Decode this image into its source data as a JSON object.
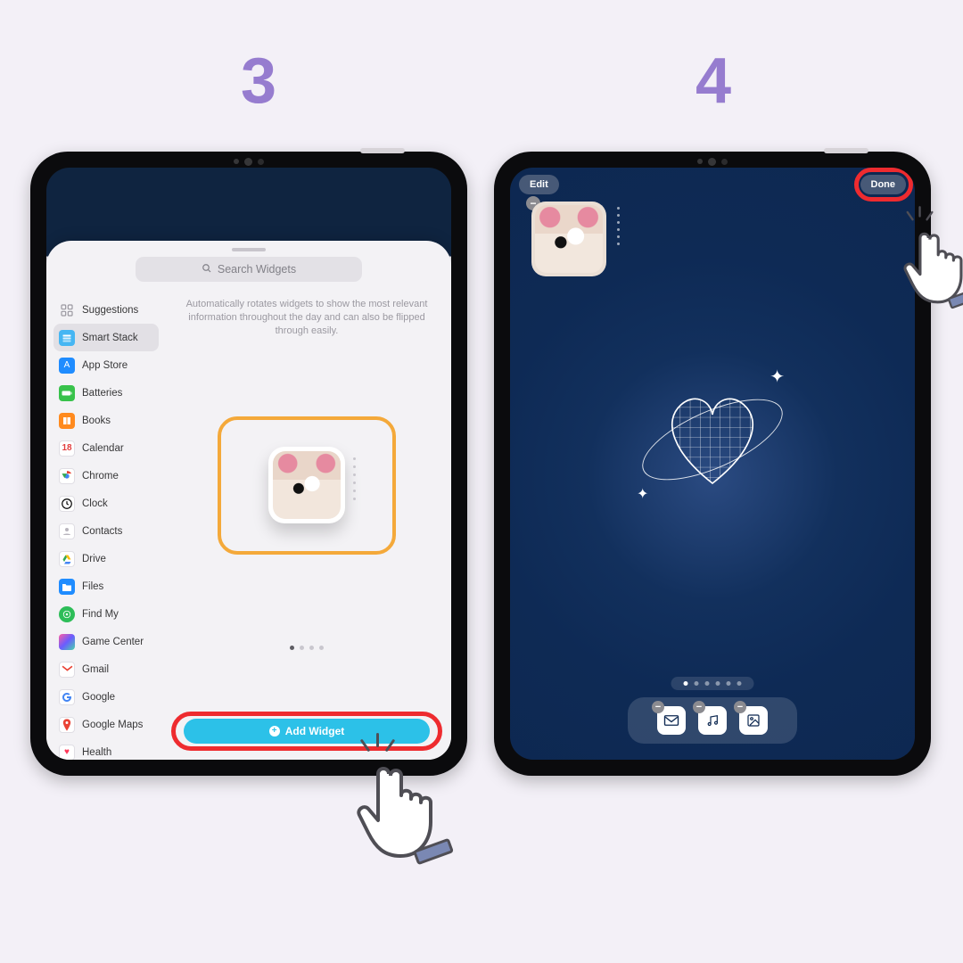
{
  "steps": {
    "left": "3",
    "right": "4"
  },
  "left": {
    "search_placeholder": "Search Widgets",
    "description": "Automatically rotates widgets to show the most relevant information throughout the day and can also be flipped through easily.",
    "add_button": "Add Widget",
    "sidebar": [
      {
        "label": "Suggestions"
      },
      {
        "label": "Smart Stack"
      },
      {
        "label": "App Store"
      },
      {
        "label": "Batteries"
      },
      {
        "label": "Books"
      },
      {
        "label": "Calendar",
        "badge": "18"
      },
      {
        "label": "Chrome"
      },
      {
        "label": "Clock"
      },
      {
        "label": "Contacts"
      },
      {
        "label": "Drive"
      },
      {
        "label": "Files"
      },
      {
        "label": "Find My"
      },
      {
        "label": "Game Center"
      },
      {
        "label": "Gmail"
      },
      {
        "label": "Google"
      },
      {
        "label": "Google Maps"
      },
      {
        "label": "Health"
      }
    ]
  },
  "right": {
    "edit_button": "Edit",
    "done_button": "Done"
  },
  "colors": {
    "step_number": "#967ccf",
    "highlight_ring": "#ee2b2f",
    "preview_ring": "#f4a93a",
    "add_button_bg": "#2cc1e8",
    "homescreen_bg": "#0e2a55"
  }
}
